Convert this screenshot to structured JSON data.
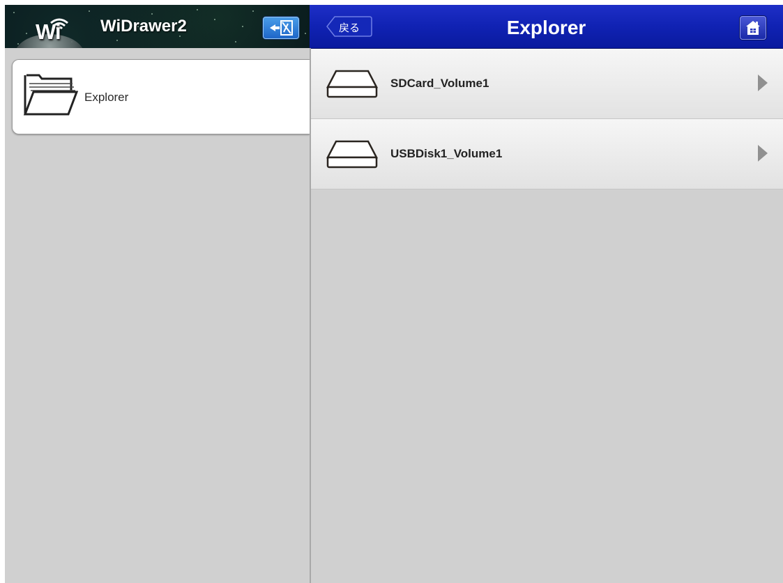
{
  "app": {
    "title": "WiDrawer2",
    "logo_text": "Wi"
  },
  "header": {
    "back_label": "戻る",
    "page_title": "Explorer"
  },
  "sidebar": {
    "items": [
      {
        "label": "Explorer",
        "icon": "folder-icon",
        "selected": true
      }
    ]
  },
  "volumes": [
    {
      "label": "SDCard_Volume1",
      "icon": "drive-icon"
    },
    {
      "label": "USBDisk1_Volume1",
      "icon": "drive-icon"
    }
  ],
  "colors": {
    "header_blue": "#1022b3",
    "logout_blue": "#1e66c8",
    "panel_gray": "#d0d0d0"
  }
}
